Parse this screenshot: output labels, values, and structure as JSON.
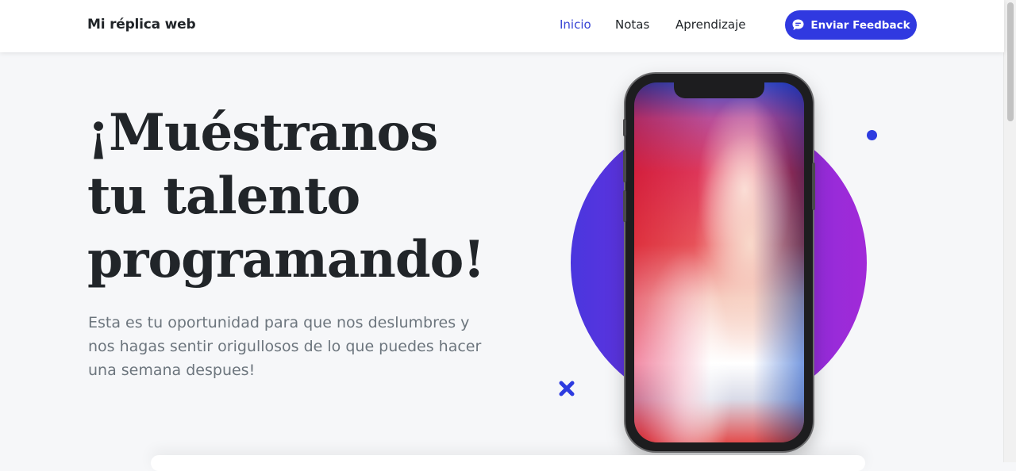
{
  "navbar": {
    "brand": "Mi réplica web",
    "links": [
      {
        "label": "Inicio",
        "active": true
      },
      {
        "label": "Notas",
        "active": false
      },
      {
        "label": "Aprendizaje",
        "active": false
      }
    ],
    "feedback_button": {
      "label": "Enviar Feedback",
      "icon": "chat-bubble-icon"
    }
  },
  "hero": {
    "title_lines": [
      "¡Muéstranos",
      "tu talento",
      "programando!"
    ],
    "subtitle": "Esta es tu oportunidad para que nos deslumbres y nos hagas sentir origullosos de lo que puedes hacer una semana despues!"
  },
  "colors": {
    "accent": "#3039e0",
    "active_link": "#3744d4",
    "title_text": "#212529",
    "subtitle_text": "#6c757d",
    "circle_gradient": [
      "#4a36de",
      "#a12ad8"
    ]
  },
  "decorations": {
    "phone": "iphone-x-mockup",
    "dot": "dot-icon",
    "cross": "x-shape-icon"
  }
}
